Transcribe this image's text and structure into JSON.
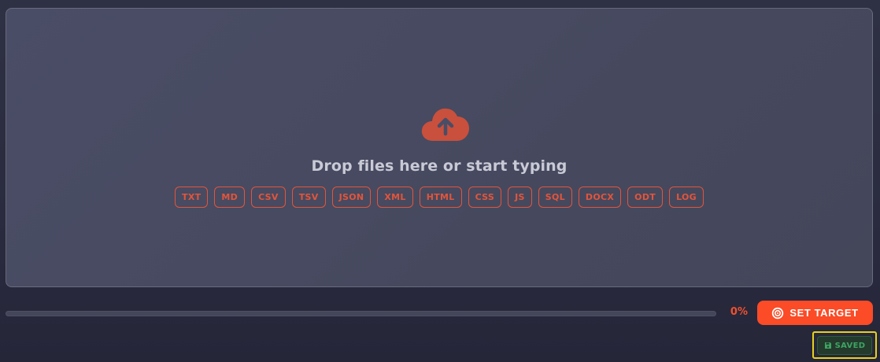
{
  "dropzone": {
    "title": "Drop files here or start typing",
    "icon": "cloud-upload-icon",
    "formats": [
      "TXT",
      "MD",
      "CSV",
      "TSV",
      "JSON",
      "XML",
      "HTML",
      "CSS",
      "JS",
      "SQL",
      "DOCX",
      "ODT",
      "LOG"
    ]
  },
  "progress": {
    "value": 0,
    "label": "0%"
  },
  "target_button": {
    "label": "SET TARGET",
    "icon": "target-icon"
  },
  "status": {
    "label": "SAVED",
    "icon": "save-icon"
  },
  "colors": {
    "accent": "#fb4b27",
    "chip": "#e2553b",
    "saved_text": "#3fa362",
    "highlight": "#e6d21a"
  }
}
